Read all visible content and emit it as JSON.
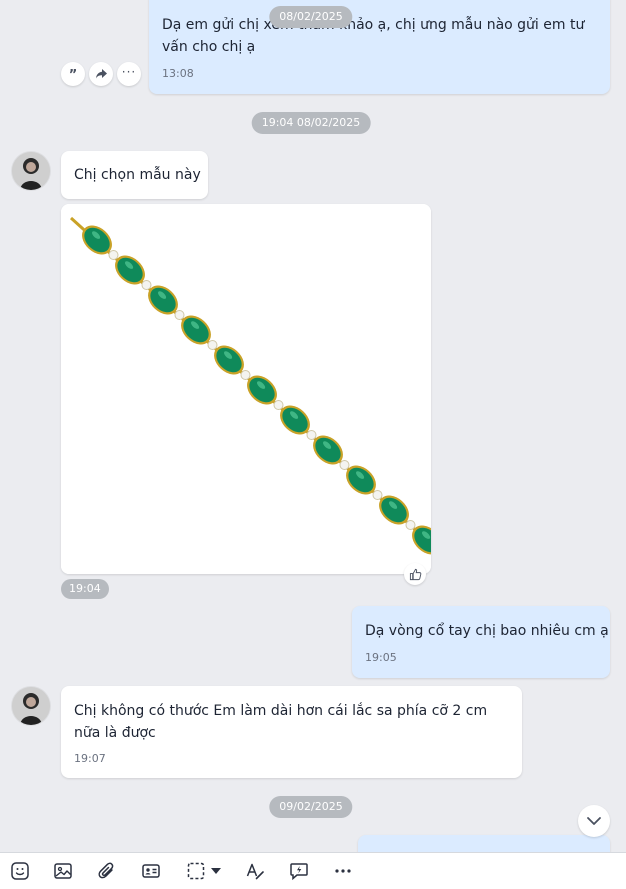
{
  "messages": {
    "m1": {
      "text": "Dạ em gửi chị xem tham khảo ạ, chị ưng mẫu nào gửi em tư vấn cho chị ạ",
      "time": "13:08"
    },
    "m2": {
      "text": "Chị chọn mẫu này"
    },
    "m3": {
      "time": "19:04"
    },
    "m4": {
      "text": "Dạ vòng cổ tay chị bao nhiêu cm ạ",
      "time": "19:05"
    },
    "m5": {
      "text": "Chị không có thước Em làm dài hơn cái lắc sa phía cỡ 2 cm nữa là được",
      "time": "19:07"
    }
  },
  "dates": {
    "d1": "08/02/2025",
    "d2": "19:04 08/02/2025",
    "d3": "09/02/2025"
  },
  "actions": {
    "quote_icon": "quote-icon",
    "forward_icon": "forward-icon",
    "more_icon": "more-icon"
  },
  "toolbar": {
    "icons": [
      "sticker-icon",
      "image-icon",
      "attachment-icon",
      "contact-card-icon",
      "screenshot-icon",
      "chevron-down-icon",
      "text-format-icon",
      "quick-message-icon",
      "more-icon"
    ]
  },
  "colors": {
    "outgoing_bubble": "#dbebff",
    "incoming_bubble": "#ffffff",
    "background": "#ebecf0",
    "emerald": "#0f8a5a",
    "gold": "#c9a227"
  }
}
